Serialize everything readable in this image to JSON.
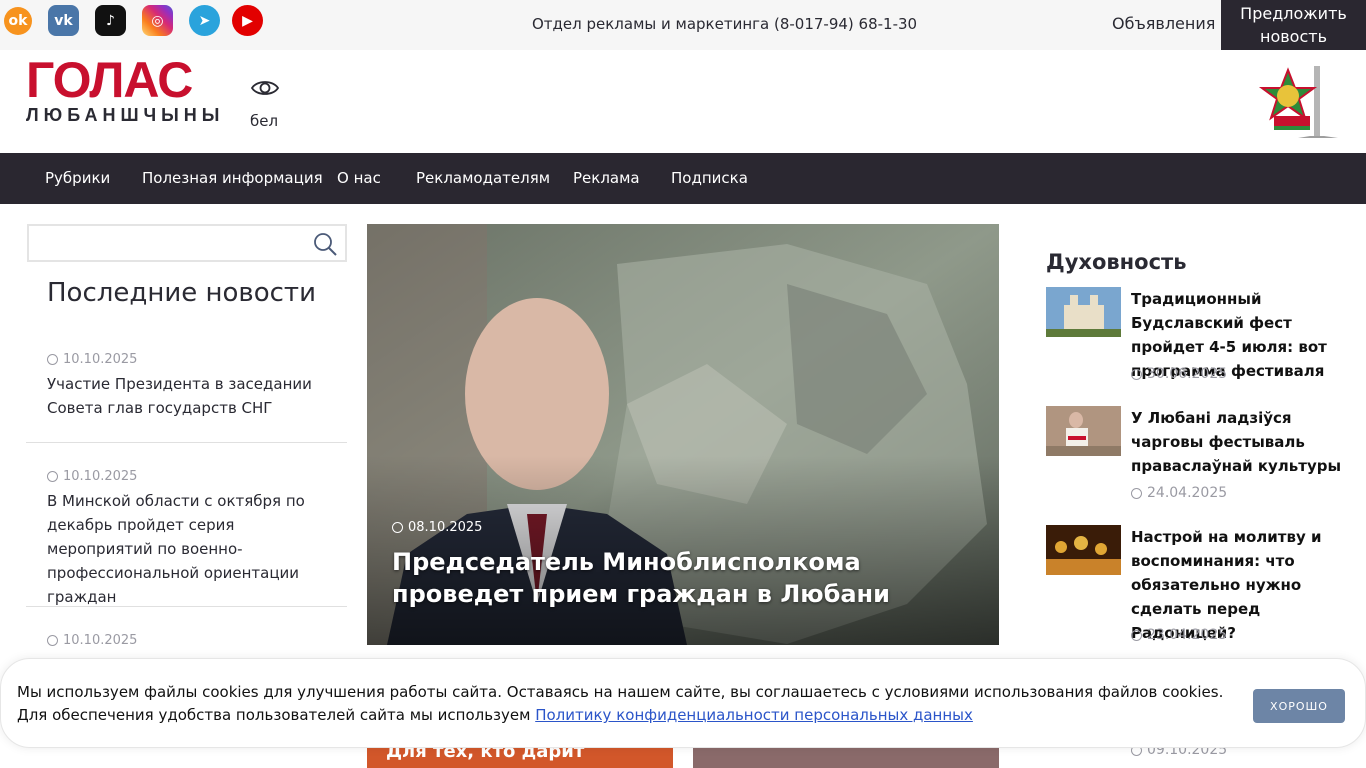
{
  "topbar": {
    "socials": [
      {
        "name": "odnoklassniki-icon",
        "glyph": "ok",
        "color": "#f7931e"
      },
      {
        "name": "vk-icon",
        "glyph": "vk",
        "color": "#4a76a8"
      },
      {
        "name": "tiktok-icon",
        "glyph": "♪",
        "color": "#111111"
      },
      {
        "name": "instagram-icon",
        "glyph": "◎",
        "color": "#d62976"
      },
      {
        "name": "telegram-icon",
        "glyph": "➤",
        "color": "#2aa3dc"
      },
      {
        "name": "youtube-icon",
        "glyph": "▶",
        "color": "#e20000"
      }
    ],
    "phone": "Отдел рекламы и маркетинга (8-017-94) 68-1-30",
    "ads_link": "Объявления",
    "suggest_line1": "Предложить",
    "suggest_line2": "новость"
  },
  "header": {
    "logo_top": "ГОЛАС",
    "logo_bottom": "ЛЮБАНШЧЫНЫ",
    "lang": "бел"
  },
  "nav": {
    "items": [
      "Рубрики",
      "Полезная информация",
      "О нас",
      "Рекламодателям",
      "Реклама",
      "Подписка"
    ]
  },
  "left": {
    "search_placeholder": "",
    "latest_title": "Последние новости",
    "news": [
      {
        "date": "10.10.2025",
        "text": "Участие Президента в заседании Совета глав государств СНГ"
      },
      {
        "date": "10.10.2025",
        "text": "В Минской области с октября по декабрь пройдет серия мероприятий по военно-профессиональной ориентации граждан"
      },
      {
        "date": "10.10.2025",
        "text": ""
      }
    ]
  },
  "hero": {
    "date": "08.10.2025",
    "title": "Председатель Миноблисполкома проведет прием граждан в Любани"
  },
  "bottom_cards": {
    "first_text": "Для тех, кто дарит"
  },
  "right": {
    "section_title": "Духовность",
    "items": [
      {
        "title": "Традиционный Будславский фест пройдет 4-5 июля: вот программа фестиваля",
        "date": "30.06.2025"
      },
      {
        "title": "У Любані ладзіўся чарговы фестываль праваслаўнай культуры",
        "date": "24.04.2025"
      },
      {
        "title": "Настрой на молитву и воспоминания: что обязательно нужно сделать перед Радоницей?",
        "date": "23.04.2025"
      }
    ],
    "hidden_date": "09.10.2025"
  },
  "cookie": {
    "line1": "Мы используем файлы cookies для улучшения работы сайта. Оставаясь на нашем сайте, вы соглашаетесь с условиями использования файлов cookies.",
    "line2_prefix": "Для обеспечения удобства пользователей сайта мы используем ",
    "link": "Политику конфиденциальности персональных данных",
    "button": "ХОРОШО"
  }
}
